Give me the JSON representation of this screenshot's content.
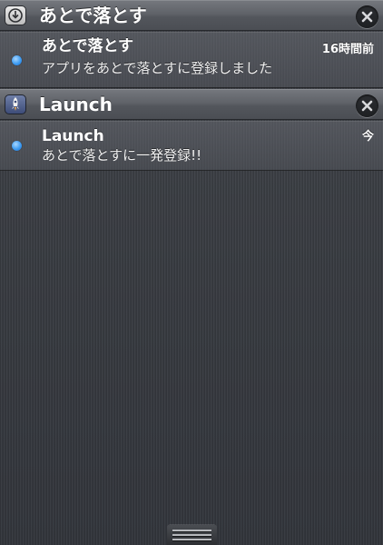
{
  "sections": [
    {
      "app_name": "あとで落とす",
      "icon": "download-icon",
      "close_icon": "close-icon",
      "notification": {
        "title": "あとで落とす",
        "time": "16時間前",
        "message": "アプリをあとで落とすに登録しました"
      }
    },
    {
      "app_name": "Launch",
      "icon": "rocket-icon",
      "close_icon": "close-icon",
      "notification": {
        "title": "Launch",
        "time": "今",
        "message": "あとで落とすに一発登録!!"
      }
    }
  ],
  "colors": {
    "unread_dot": "#3e9cf2",
    "background": "#3b3e44"
  }
}
